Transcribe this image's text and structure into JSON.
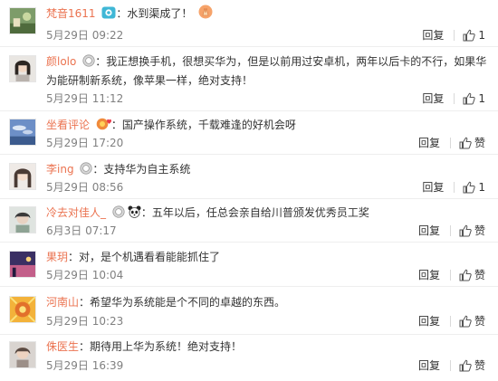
{
  "comments": [
    {
      "user": "梵音1611",
      "separator": "：",
      "text": "水到渠成了！",
      "time": "5月29日 09:22",
      "reply_label": "回复",
      "like_label": "1",
      "badges": [
        "vip-camera-icon"
      ],
      "emoji": "praying-hands-emoji-icon"
    },
    {
      "user": "颜lolo",
      "separator": "：",
      "text": "我正想换手机，很想买华为，但是以前用过安卓机，两年以后卡的不行，如果华为能研制新系统，像苹果一样，绝对支持！",
      "time": "5月29日 11:12",
      "reply_label": "回复",
      "like_label": "1",
      "badges": [
        "member-medal-icon"
      ]
    },
    {
      "user": "坐看评论",
      "separator": "：",
      "text": "国产操作系统，千载难逢的好机会呀",
      "time": "5月29日 17:20",
      "reply_label": "回复",
      "like_label": "赞",
      "badges": [
        "fans-heart-icon"
      ]
    },
    {
      "user": "李ing",
      "separator": "：",
      "text": "支持华为自主系统",
      "time": "5月29日 08:56",
      "reply_label": "回复",
      "like_label": "1",
      "badges": [
        "member-medal-icon"
      ]
    },
    {
      "user": "冷去对佳人_",
      "separator": "：",
      "text": "五年以后，任总会亲自给川普颁发优秀员工奖",
      "time": "6月3日 07:17",
      "reply_label": "回复",
      "like_label": "赞",
      "badges": [
        "member-medal-icon",
        "panda-icon"
      ]
    },
    {
      "user": "果玥",
      "separator": "：",
      "text": "对，是个机遇看看能能抓住了",
      "time": "5月29日 10:04",
      "reply_label": "回复",
      "like_label": "赞",
      "badges": []
    },
    {
      "user": "河南山",
      "separator": "：",
      "text": "希望华为系统能是个不同的卓越的东西。",
      "time": "5月29日 10:23",
      "reply_label": "回复",
      "like_label": "赞",
      "badges": []
    },
    {
      "user": "侏医生",
      "separator": "：",
      "text": "期待用上华为系统！绝对支持！",
      "time": "5月29日 16:39",
      "reply_label": "回复",
      "like_label": "赞",
      "badges": []
    }
  ],
  "colors": {
    "username": "#eb7350",
    "timestamp": "#808080",
    "text": "#333333",
    "divider": "#eeeeee"
  }
}
